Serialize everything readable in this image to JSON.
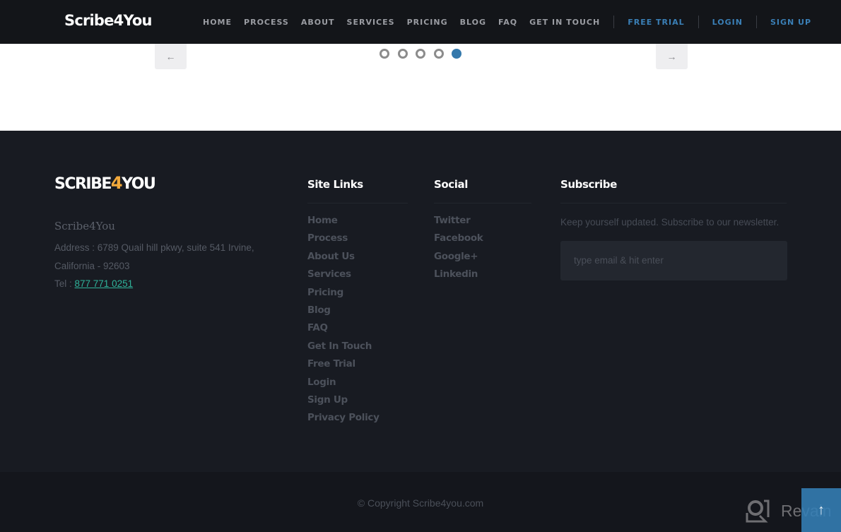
{
  "header": {
    "brand": "Scribe4You",
    "nav": [
      "HOME",
      "PROCESS",
      "ABOUT",
      "SERVICES",
      "PRICING",
      "BLOG",
      "FAQ",
      "GET IN TOUCH"
    ],
    "free_trial": "FREE TRIAL",
    "login": "LOGIN",
    "sign_up": "SIGN UP",
    "accent_color": "#3a7fb6"
  },
  "carousel": {
    "prev_icon": "←",
    "next_icon": "→",
    "slide_count": 5,
    "active_slide": 5,
    "active_color": "#3579ac"
  },
  "footer": {
    "logo": {
      "part1": "SCRIBE",
      "part2": "4",
      "part3": "YOU"
    },
    "company": "Scribe4You",
    "address_line": "Address : 6789 Quail hill pkwy, suite 541 Irvine, California - 92603",
    "tel_label": "Tel : ",
    "tel": "877 771 0251",
    "site_links": {
      "title": "Site Links",
      "items": [
        "Home",
        "Process",
        "About Us",
        "Services",
        "Pricing",
        "Blog",
        "FAQ",
        "Get In Touch",
        "Free Trial",
        "Login",
        "Sign Up",
        "Privacy Policy"
      ]
    },
    "social": {
      "title": "Social",
      "items": [
        "Twitter",
        "Facebook",
        "Google+",
        "Linkedin"
      ]
    },
    "subscribe": {
      "title": "Subscribe",
      "text": "Keep yourself updated. Subscribe to our newsletter.",
      "placeholder": "type email & hit enter",
      "value": ""
    },
    "copyright": "© Copyright Scribe4you.com"
  },
  "overlay": {
    "revain_label": "Revain",
    "to_top_icon": "↑"
  }
}
